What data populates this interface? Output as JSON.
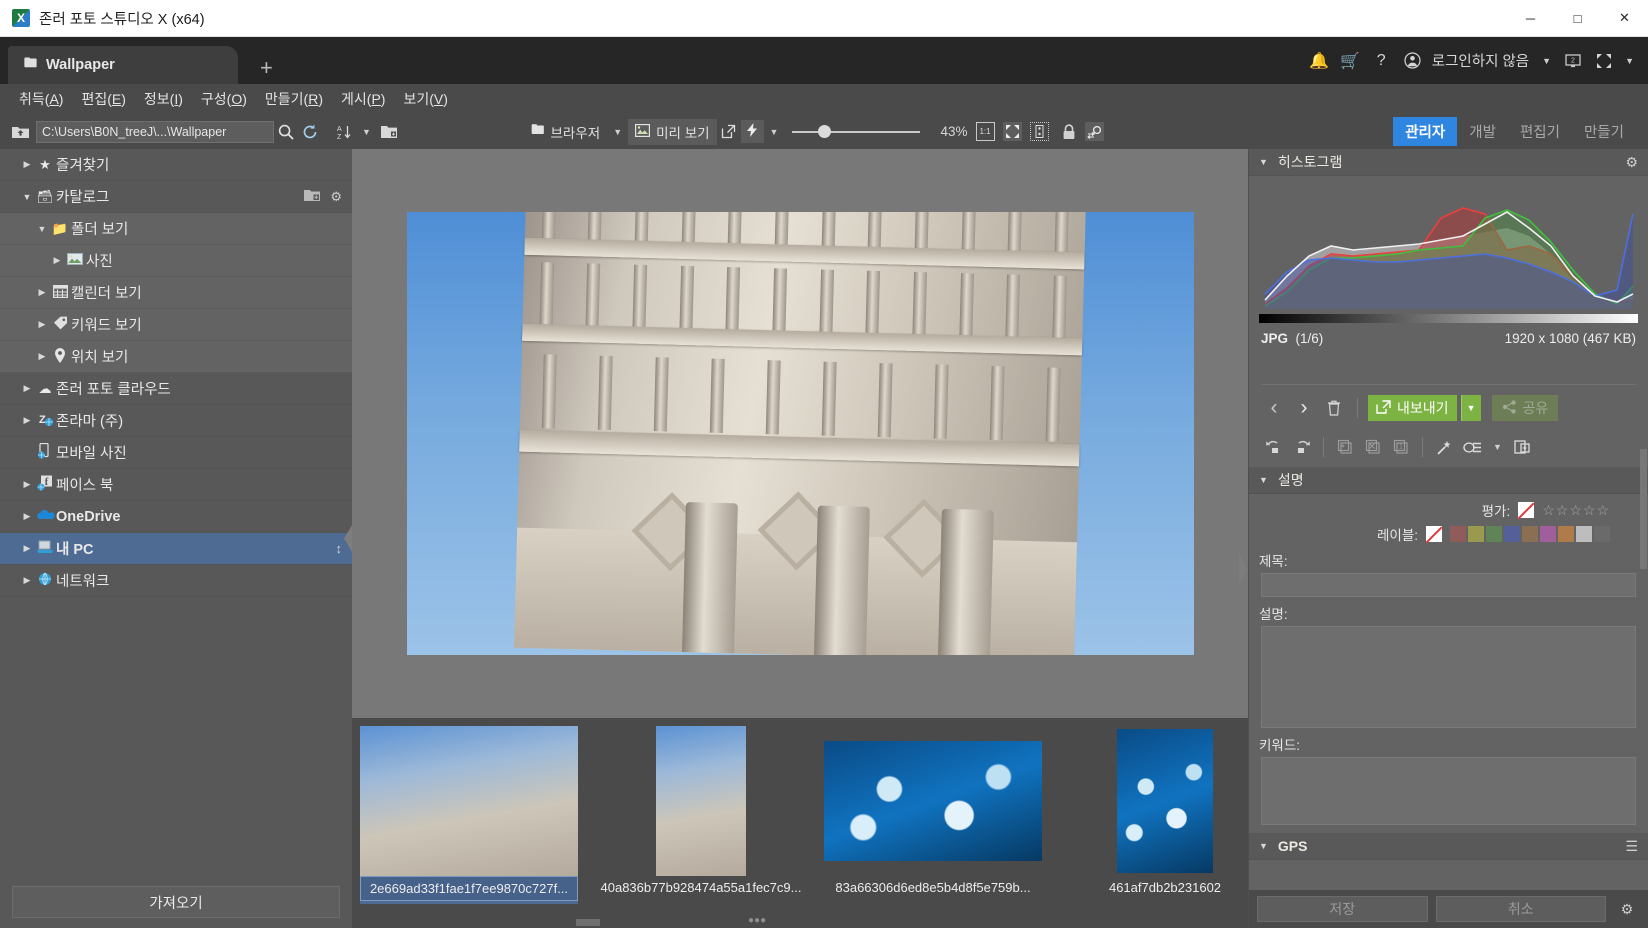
{
  "window": {
    "title": "존러 포토 스튜디오 X (x64)",
    "app_icon": "photo-studio-icon",
    "minimize": "─",
    "maximize": "□",
    "close": "✕"
  },
  "tabbar": {
    "tab_label": "Wallpaper",
    "tab_icon": "folder-icon",
    "add_tab": "+",
    "account": {
      "bell_icon": "🔔",
      "cart_icon": "🛒",
      "help_icon": "?",
      "user_icon": "ⓤ",
      "name": "로그인하지 않음",
      "caret": "▼",
      "screen_icon": "screen-2-icon",
      "fullscreen_icon": "expand-icon",
      "fullscreen_caret": "▼"
    }
  },
  "menubar": {
    "items": [
      {
        "text": "취득",
        "key": "A"
      },
      {
        "text": "편집",
        "key": "E"
      },
      {
        "text": "정보",
        "key": "I"
      },
      {
        "text": "구성",
        "key": "O"
      },
      {
        "text": "만들기",
        "key": "R"
      },
      {
        "text": "게시",
        "key": "P"
      },
      {
        "text": "보기",
        "key": "V"
      }
    ]
  },
  "toolbar": {
    "up_icon": "folder-up-icon",
    "path": "C:\\Users\\B0N_treeJ\\...\\Wallpaper",
    "search_icon": "search-icon",
    "refresh_icon": "refresh-icon",
    "sort_icon": "sort-az-icon",
    "sort_caret": "▼",
    "addfolder_icon": "add-folder-icon",
    "browser_label": "브라우저",
    "browser_icon": "folder-icon",
    "browser_caret": "▼",
    "preview_label": "미리 보기",
    "preview_icon": "image-icon",
    "popout_icon": "popout-icon",
    "quick_icon": "lightning-icon",
    "quick_caret": "▼",
    "zoom_percent": "43%",
    "one_to_one": "1:1",
    "fit_icon": "fit-screen-icon",
    "compare_icon": "compare-icon",
    "lock_icon": "lock-icon",
    "search_compare_icon": "swap-search-icon",
    "modes": [
      {
        "label": "관리자",
        "active": true
      },
      {
        "label": "개발",
        "active": false
      },
      {
        "label": "편집기",
        "active": false
      },
      {
        "label": "만들기",
        "active": false
      }
    ]
  },
  "sidebar": {
    "items": [
      {
        "label": "즐겨찾기",
        "icon": "star-icon",
        "arrow": "▶",
        "indent": 0,
        "selected": false,
        "sub": false
      },
      {
        "label": "카탈로그",
        "icon": "catalog-icon",
        "arrow": "▼",
        "indent": 0,
        "selected": false,
        "sub": false,
        "tools": [
          "add-catalog-icon",
          "gear-icon"
        ]
      },
      {
        "label": "폴더 보기",
        "icon": "folder-icon",
        "arrow": "▼",
        "indent": 1,
        "selected": false,
        "sub": true
      },
      {
        "label": "사진",
        "icon": "photo-icon",
        "arrow": "▶",
        "indent": 2,
        "selected": false,
        "sub": true
      },
      {
        "label": "캘린더 보기",
        "icon": "calendar-icon",
        "arrow": "▶",
        "indent": 1,
        "selected": false,
        "sub": true
      },
      {
        "label": "키워드 보기",
        "icon": "tag-icon",
        "arrow": "▶",
        "indent": 1,
        "selected": false,
        "sub": true
      },
      {
        "label": "위치 보기",
        "icon": "pin-icon",
        "arrow": "▶",
        "indent": 1,
        "selected": false,
        "sub": true
      },
      {
        "label": "존러 포토 클라우드",
        "icon": "cloud-icon",
        "arrow": "▶",
        "indent": 0,
        "selected": false,
        "sub": false
      },
      {
        "label": "존라마 (주)",
        "icon": "z-globe-icon",
        "arrow": "▶",
        "indent": 0,
        "selected": false,
        "sub": false
      },
      {
        "label": "모바일 사진",
        "icon": "mobile-icon",
        "arrow": "",
        "indent": 0,
        "selected": false,
        "sub": false
      },
      {
        "label": "페이스 북",
        "icon": "facebook-icon",
        "arrow": "▶",
        "indent": 0,
        "selected": false,
        "sub": false
      },
      {
        "label": "OneDrive",
        "icon": "onedrive-icon",
        "arrow": "▶",
        "indent": 0,
        "selected": false,
        "sub": false
      },
      {
        "label": "내 PC",
        "icon": "computer-icon",
        "arrow": "▶",
        "indent": 0,
        "selected": true,
        "sub": false
      },
      {
        "label": "네트워크",
        "icon": "network-icon",
        "arrow": "▶",
        "indent": 0,
        "selected": false,
        "sub": false
      }
    ],
    "import_button": "가져오기"
  },
  "filmstrip": {
    "thumbs": [
      {
        "name": "2e669ad33f1fae1f7ee9870c727f...",
        "kind": "tower",
        "selected": true
      },
      {
        "name": "40a836b77b928474a55a1fec7c9...",
        "kind": "tower",
        "selected": false
      },
      {
        "name": "83a66306d6ed8e5b4d8f5e759b...",
        "kind": "ice",
        "selected": false
      },
      {
        "name": "461af7db2b231602",
        "kind": "ice",
        "selected": false
      }
    ]
  },
  "rightpanel": {
    "histogram_title": "히스토그램",
    "histogram_gear": "gear-icon",
    "file_format": "JPG",
    "file_index": "(1/6)",
    "file_dimensions": "1920 x 1080 (467 KB)",
    "nav": {
      "prev": "‹",
      "next": "›",
      "delete": "delete-icon"
    },
    "export_label": "내보내기",
    "export_caret": "▼",
    "share_label": "공유",
    "share_icon": "share-icon",
    "tools": [
      "rotate-left-icon",
      "rotate-right-icon",
      "copy-icon",
      "remove-icon",
      "single-icon",
      "magic-wand-icon",
      "stack-icon",
      "stack-caret",
      "add-page-icon"
    ],
    "description_title": "설명",
    "rating_label": "평가:",
    "rating_stars": "☆☆☆☆☆",
    "label_label": "레이블:",
    "label_colors": [
      "#8f5b5b",
      "#9a9a4f",
      "#5f8458",
      "#55609b",
      "#8b6f52",
      "#a05f9c",
      "#b07b4a",
      "#bdbdbd",
      "#6a6a6a"
    ],
    "title_label": "제목:",
    "title_value": "",
    "desc_label": "설명:",
    "desc_value": "",
    "keyword_label": "키워드:",
    "keyword_value": "",
    "gps_title": "GPS",
    "gps_menu_icon": "menu-icon",
    "save_label": "저장",
    "cancel_label": "취소",
    "settings_icon": "gear-icon"
  },
  "chart_data": {
    "type": "area",
    "title": "히스토그램",
    "xlabel": "",
    "ylabel": "",
    "x": [
      0,
      16,
      32,
      48,
      64,
      80,
      96,
      112,
      128,
      144,
      160,
      176,
      192,
      208,
      224,
      240,
      255
    ],
    "series": [
      {
        "name": "Red",
        "color": "#e04b4b",
        "values": [
          4,
          22,
          45,
          52,
          48,
          52,
          58,
          95,
          98,
          62,
          60,
          64,
          52,
          38,
          22,
          10,
          6
        ]
      },
      {
        "name": "Green",
        "color": "#4fc14f",
        "values": [
          4,
          20,
          44,
          52,
          50,
          52,
          54,
          58,
          62,
          86,
          100,
          92,
          70,
          42,
          18,
          9,
          12
        ]
      },
      {
        "name": "Blue",
        "color": "#4e6fd8",
        "values": [
          12,
          34,
          48,
          50,
          47,
          48,
          50,
          52,
          54,
          50,
          44,
          38,
          30,
          22,
          16,
          28,
          96
        ]
      },
      {
        "name": "Luma",
        "color": "#e8e8e8",
        "values": [
          5,
          24,
          46,
          52,
          49,
          51,
          55,
          60,
          66,
          92,
          98,
          88,
          66,
          40,
          18,
          10,
          14
        ]
      }
    ],
    "legend": false,
    "grid": false
  }
}
